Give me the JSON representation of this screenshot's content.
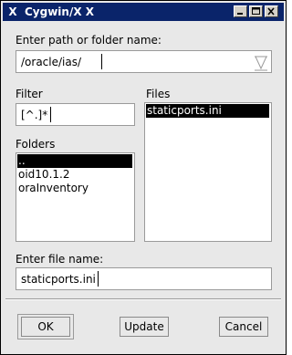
{
  "window": {
    "title": "Cygwin/X X",
    "app_icon": "x-logo-icon",
    "controls": [
      "minimize-icon",
      "maximize-icon",
      "close-icon"
    ]
  },
  "path": {
    "label": "Enter path or folder name:",
    "value": "/oracle/ias/",
    "browse_icon": "folder-down-icon"
  },
  "filter": {
    "label": "Filter",
    "value": "[^.]*"
  },
  "files": {
    "label": "Files",
    "items": [
      "staticports.ini"
    ],
    "selected_index": 0
  },
  "folders": {
    "label": "Folders",
    "items": [
      "..",
      "oid10.1.2",
      "oraInventory"
    ],
    "selected_index": 0
  },
  "filename": {
    "label": "Enter file name:",
    "value": "staticports.ini"
  },
  "buttons": {
    "ok": "OK",
    "update": "Update",
    "cancel": "Cancel"
  },
  "colors": {
    "titlebar": "#0a246a",
    "dialog_bg": "#e8e8e8",
    "selection": "#000000"
  }
}
